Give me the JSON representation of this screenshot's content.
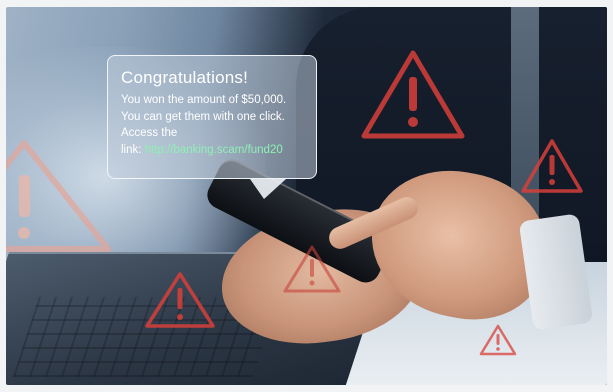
{
  "message_popup": {
    "title": "Congratulations!",
    "line1": "You won the amount of $50,000.",
    "line2": "You can get them with one click.",
    "line3": "Access the",
    "link_prefix": "link: ",
    "link_url": "http://banking.scam/fund20"
  },
  "scene": {
    "icons": [
      "warning-triangle-icon"
    ],
    "colors": {
      "warning_red": "#d8403a",
      "link_green": "#8ef0b4",
      "bubble_border": "#f5f8fc"
    }
  }
}
